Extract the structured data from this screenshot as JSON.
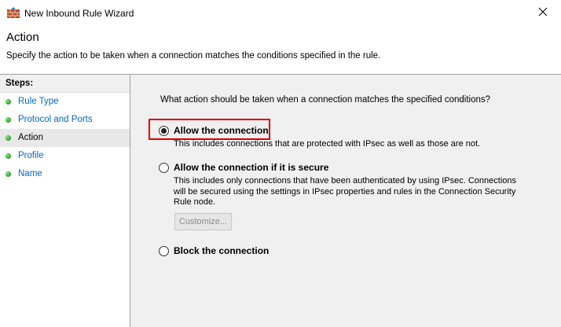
{
  "window": {
    "title": "New Inbound Rule Wizard",
    "icons": {
      "app": "firewall-wall-icon",
      "close": "close-icon"
    }
  },
  "header": {
    "title": "Action",
    "subtitle": "Specify the action to be taken when a connection matches the conditions specified in the rule."
  },
  "steps": {
    "header": "Steps:",
    "items": [
      {
        "label": "Rule Type",
        "state": "link"
      },
      {
        "label": "Protocol and Ports",
        "state": "link"
      },
      {
        "label": "Action",
        "state": "current"
      },
      {
        "label": "Profile",
        "state": "link"
      },
      {
        "label": "Name",
        "state": "link"
      }
    ]
  },
  "main": {
    "question": "What action should be taken when a connection matches the specified conditions?",
    "options": [
      {
        "label": "Allow the connection",
        "description": "This includes connections that are protected with IPsec as well as those are not.",
        "selected": true
      },
      {
        "label": "Allow the connection if it is secure",
        "description": "This includes only connections that have been authenticated by using IPsec.  Connections will be secured using the settings in IPsec properties and rules in the Connection Security Rule node.",
        "selected": false
      },
      {
        "label": "Block the connection",
        "description": "",
        "selected": false
      }
    ],
    "customize_label": "Customize...",
    "customize_enabled": false
  },
  "colors": {
    "link": "#0066cc",
    "highlight": "#e00000",
    "step_dot": "#1ea31e"
  }
}
